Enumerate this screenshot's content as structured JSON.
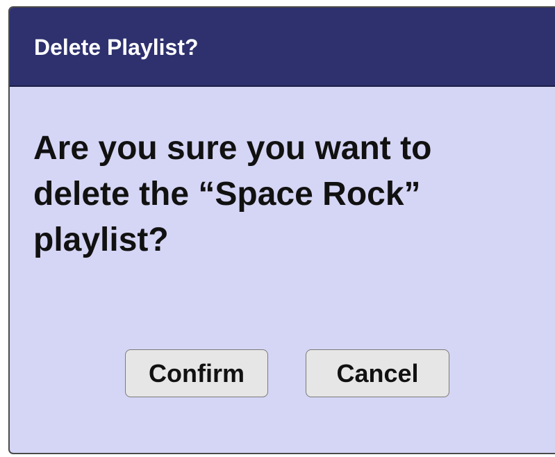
{
  "dialog": {
    "title": "Delete Playlist?",
    "message": "Are you sure you want to delete the “Space Rock” playlist?",
    "confirm_label": "Confirm",
    "cancel_label": "Cancel"
  },
  "colors": {
    "header_background": "#2e316e",
    "body_background": "#d5d5f5",
    "button_background": "#e6e6e6",
    "title_text": "#ffffff",
    "body_text": "#111111"
  }
}
